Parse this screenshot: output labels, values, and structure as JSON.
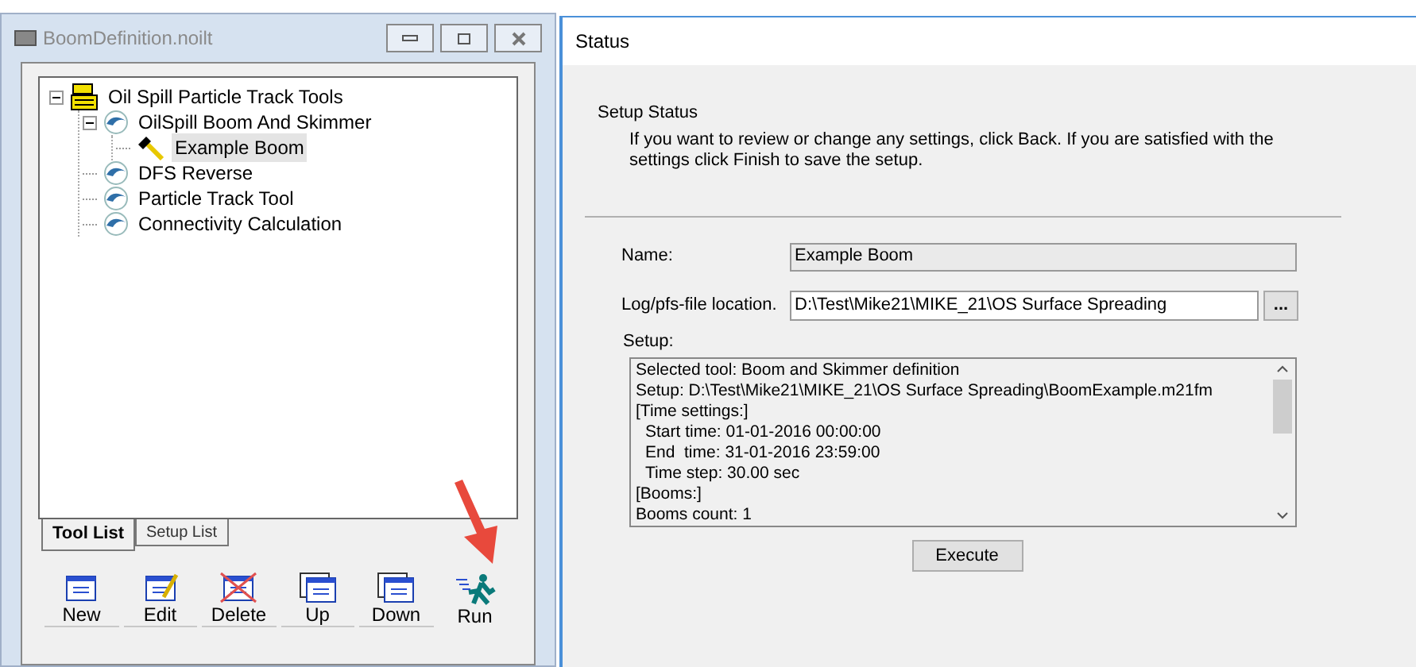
{
  "left_window": {
    "title": "BoomDefinition.noilt",
    "tree": [
      {
        "label": "Oil Spill Particle Track Tools",
        "kind": "toolbox",
        "expanded": true,
        "selected": false,
        "children": [
          {
            "label": "OilSpill Boom And Skimmer",
            "kind": "tool",
            "expanded": true,
            "selected": false,
            "children": [
              {
                "label": "Example Boom",
                "kind": "setup",
                "selected": true
              }
            ]
          },
          {
            "label": "DFS Reverse",
            "kind": "tool",
            "selected": false
          },
          {
            "label": "Particle Track Tool",
            "kind": "tool",
            "selected": false
          },
          {
            "label": "Connectivity Calculation",
            "kind": "tool",
            "selected": false
          }
        ]
      }
    ],
    "tabs": [
      {
        "label": "Tool List",
        "selected": true
      },
      {
        "label": "Setup List",
        "selected": false
      }
    ],
    "toolbar": [
      {
        "label": "New",
        "kind": "new"
      },
      {
        "label": "Edit",
        "kind": "edit"
      },
      {
        "label": "Delete",
        "kind": "delete"
      },
      {
        "label": "Up",
        "kind": "up"
      },
      {
        "label": "Down",
        "kind": "down"
      },
      {
        "label": "Run",
        "kind": "run"
      }
    ]
  },
  "status_panel": {
    "title": "Status",
    "heading": "Setup Status",
    "description": "If you want to review or change any settings, click Back. If you are satisfied with the settings click Finish to save the setup.",
    "name_label": "Name:",
    "name_value": "Example Boom",
    "location_label": "Log/pfs-file location.",
    "location_value": "D:\\Test\\Mike21\\MIKE_21\\OS Surface Spreading",
    "browse_button": "...",
    "setup_label": "Setup:",
    "setup_lines": [
      {
        "text": "Selected tool: Boom and Skimmer definition",
        "indented": false
      },
      {
        "text": "Setup: D:\\Test\\Mike21\\MIKE_21\\OS Surface Spreading\\BoomExample.m21fm",
        "indented": false
      },
      {
        "text": "[Time settings:]",
        "indented": false
      },
      {
        "text": "Start time: 01-01-2016 00:00:00",
        "indented": true
      },
      {
        "text": "End  time: 31-01-2016 23:59:00",
        "indented": true
      },
      {
        "text": "Time step: 30.00 sec",
        "indented": true
      },
      {
        "text": "[Booms:]",
        "indented": false
      },
      {
        "text": "Booms count: 1",
        "indented": false
      }
    ],
    "execute_button": "Execute"
  }
}
